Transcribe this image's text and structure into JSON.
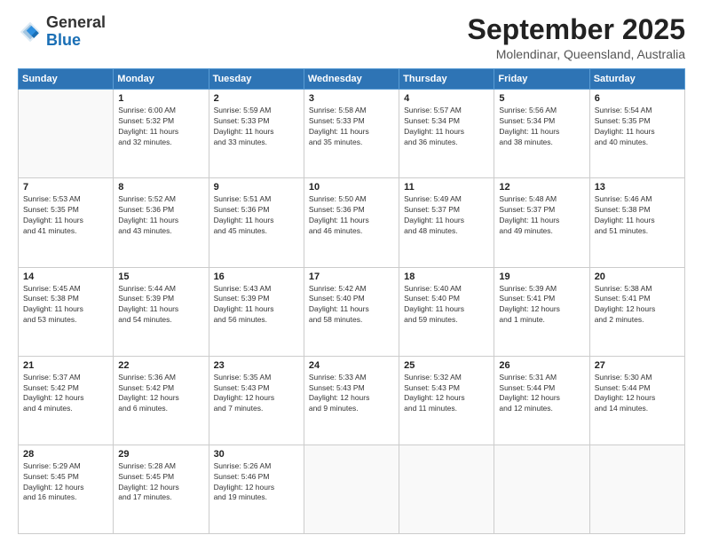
{
  "logo": {
    "general": "General",
    "blue": "Blue"
  },
  "header": {
    "month": "September 2025",
    "location": "Molendinar, Queensland, Australia"
  },
  "days_of_week": [
    "Sunday",
    "Monday",
    "Tuesday",
    "Wednesday",
    "Thursday",
    "Friday",
    "Saturday"
  ],
  "weeks": [
    [
      {
        "day": "",
        "info": ""
      },
      {
        "day": "1",
        "info": "Sunrise: 6:00 AM\nSunset: 5:32 PM\nDaylight: 11 hours\nand 32 minutes."
      },
      {
        "day": "2",
        "info": "Sunrise: 5:59 AM\nSunset: 5:33 PM\nDaylight: 11 hours\nand 33 minutes."
      },
      {
        "day": "3",
        "info": "Sunrise: 5:58 AM\nSunset: 5:33 PM\nDaylight: 11 hours\nand 35 minutes."
      },
      {
        "day": "4",
        "info": "Sunrise: 5:57 AM\nSunset: 5:34 PM\nDaylight: 11 hours\nand 36 minutes."
      },
      {
        "day": "5",
        "info": "Sunrise: 5:56 AM\nSunset: 5:34 PM\nDaylight: 11 hours\nand 38 minutes."
      },
      {
        "day": "6",
        "info": "Sunrise: 5:54 AM\nSunset: 5:35 PM\nDaylight: 11 hours\nand 40 minutes."
      }
    ],
    [
      {
        "day": "7",
        "info": "Sunrise: 5:53 AM\nSunset: 5:35 PM\nDaylight: 11 hours\nand 41 minutes."
      },
      {
        "day": "8",
        "info": "Sunrise: 5:52 AM\nSunset: 5:36 PM\nDaylight: 11 hours\nand 43 minutes."
      },
      {
        "day": "9",
        "info": "Sunrise: 5:51 AM\nSunset: 5:36 PM\nDaylight: 11 hours\nand 45 minutes."
      },
      {
        "day": "10",
        "info": "Sunrise: 5:50 AM\nSunset: 5:36 PM\nDaylight: 11 hours\nand 46 minutes."
      },
      {
        "day": "11",
        "info": "Sunrise: 5:49 AM\nSunset: 5:37 PM\nDaylight: 11 hours\nand 48 minutes."
      },
      {
        "day": "12",
        "info": "Sunrise: 5:48 AM\nSunset: 5:37 PM\nDaylight: 11 hours\nand 49 minutes."
      },
      {
        "day": "13",
        "info": "Sunrise: 5:46 AM\nSunset: 5:38 PM\nDaylight: 11 hours\nand 51 minutes."
      }
    ],
    [
      {
        "day": "14",
        "info": "Sunrise: 5:45 AM\nSunset: 5:38 PM\nDaylight: 11 hours\nand 53 minutes."
      },
      {
        "day": "15",
        "info": "Sunrise: 5:44 AM\nSunset: 5:39 PM\nDaylight: 11 hours\nand 54 minutes."
      },
      {
        "day": "16",
        "info": "Sunrise: 5:43 AM\nSunset: 5:39 PM\nDaylight: 11 hours\nand 56 minutes."
      },
      {
        "day": "17",
        "info": "Sunrise: 5:42 AM\nSunset: 5:40 PM\nDaylight: 11 hours\nand 58 minutes."
      },
      {
        "day": "18",
        "info": "Sunrise: 5:40 AM\nSunset: 5:40 PM\nDaylight: 11 hours\nand 59 minutes."
      },
      {
        "day": "19",
        "info": "Sunrise: 5:39 AM\nSunset: 5:41 PM\nDaylight: 12 hours\nand 1 minute."
      },
      {
        "day": "20",
        "info": "Sunrise: 5:38 AM\nSunset: 5:41 PM\nDaylight: 12 hours\nand 2 minutes."
      }
    ],
    [
      {
        "day": "21",
        "info": "Sunrise: 5:37 AM\nSunset: 5:42 PM\nDaylight: 12 hours\nand 4 minutes."
      },
      {
        "day": "22",
        "info": "Sunrise: 5:36 AM\nSunset: 5:42 PM\nDaylight: 12 hours\nand 6 minutes."
      },
      {
        "day": "23",
        "info": "Sunrise: 5:35 AM\nSunset: 5:43 PM\nDaylight: 12 hours\nand 7 minutes."
      },
      {
        "day": "24",
        "info": "Sunrise: 5:33 AM\nSunset: 5:43 PM\nDaylight: 12 hours\nand 9 minutes."
      },
      {
        "day": "25",
        "info": "Sunrise: 5:32 AM\nSunset: 5:43 PM\nDaylight: 12 hours\nand 11 minutes."
      },
      {
        "day": "26",
        "info": "Sunrise: 5:31 AM\nSunset: 5:44 PM\nDaylight: 12 hours\nand 12 minutes."
      },
      {
        "day": "27",
        "info": "Sunrise: 5:30 AM\nSunset: 5:44 PM\nDaylight: 12 hours\nand 14 minutes."
      }
    ],
    [
      {
        "day": "28",
        "info": "Sunrise: 5:29 AM\nSunset: 5:45 PM\nDaylight: 12 hours\nand 16 minutes."
      },
      {
        "day": "29",
        "info": "Sunrise: 5:28 AM\nSunset: 5:45 PM\nDaylight: 12 hours\nand 17 minutes."
      },
      {
        "day": "30",
        "info": "Sunrise: 5:26 AM\nSunset: 5:46 PM\nDaylight: 12 hours\nand 19 minutes."
      },
      {
        "day": "",
        "info": ""
      },
      {
        "day": "",
        "info": ""
      },
      {
        "day": "",
        "info": ""
      },
      {
        "day": "",
        "info": ""
      }
    ]
  ]
}
